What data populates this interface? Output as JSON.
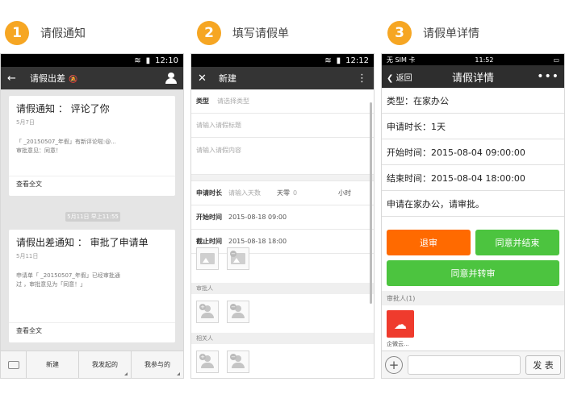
{
  "steps": [
    {
      "num": "1",
      "label": "请假通知"
    },
    {
      "num": "2",
      "label": "填写请假单"
    },
    {
      "num": "3",
      "label": "请假单详情"
    }
  ],
  "phone1": {
    "status": {
      "time": "12:10"
    },
    "appbar": {
      "title": "请假出差"
    },
    "cards": [
      {
        "title": "请假通知 ：  评论了你",
        "date": "5月7日",
        "body_line1": "「 _20150507_年假」有新评论啦:@...",
        "body_line2": "审批意见：同意！",
        "more": "查看全文"
      },
      {
        "title": "请假出差通知 ：  审批了申请单",
        "date": "5月11日",
        "body_line1": "申请单「 _20150507_年假」已经审批通",
        "body_line2": "过 ，审批意见为「同意！」",
        "more": "查看全文"
      }
    ],
    "timestamp": "5月11日 早上11:55",
    "tabs": [
      "新建",
      "我发起的",
      "我参与的"
    ]
  },
  "phone2": {
    "status": {
      "time": "12:12"
    },
    "appbar": {
      "title": "新建"
    },
    "type_label": "类型",
    "type_placeholder": "请选择类型",
    "title_placeholder": "请输入请假标题",
    "content_placeholder": "请输入请假内容",
    "duration_label": "申请时长",
    "duration_placeholder": "请输入天数",
    "days_label": "天零",
    "days_value": "0",
    "hours_label": "小时",
    "start_label": "开始时间",
    "start_value": "2015-08-18 09:00",
    "end_label": "截止时间",
    "end_value": "2015-08-18 18:00",
    "approver_section": "审批人",
    "related_section": "相关人"
  },
  "phone3": {
    "status": {
      "carrier": "无 SIM 卡",
      "time": "11:52"
    },
    "nav": {
      "back": "返回",
      "title": "请假详情"
    },
    "rows": [
      "类型：在家办公",
      "申请时长：1天",
      "开始时间：2015-08-04 09:00:00",
      "结束时间：2015-08-04 18:00:00",
      "申请在家办公，请审批。"
    ],
    "buttons": {
      "reject": "退审",
      "approve_end": "同意并结束",
      "approve_forward": "同意并转审"
    },
    "approver_section": "审批人(1)",
    "approver_name": "企微云...",
    "send": "发 表"
  },
  "colors": {
    "step_badge": "#f6a623",
    "orange": "#ff6a00",
    "green": "#4cc43f",
    "appbar": "#343434"
  }
}
